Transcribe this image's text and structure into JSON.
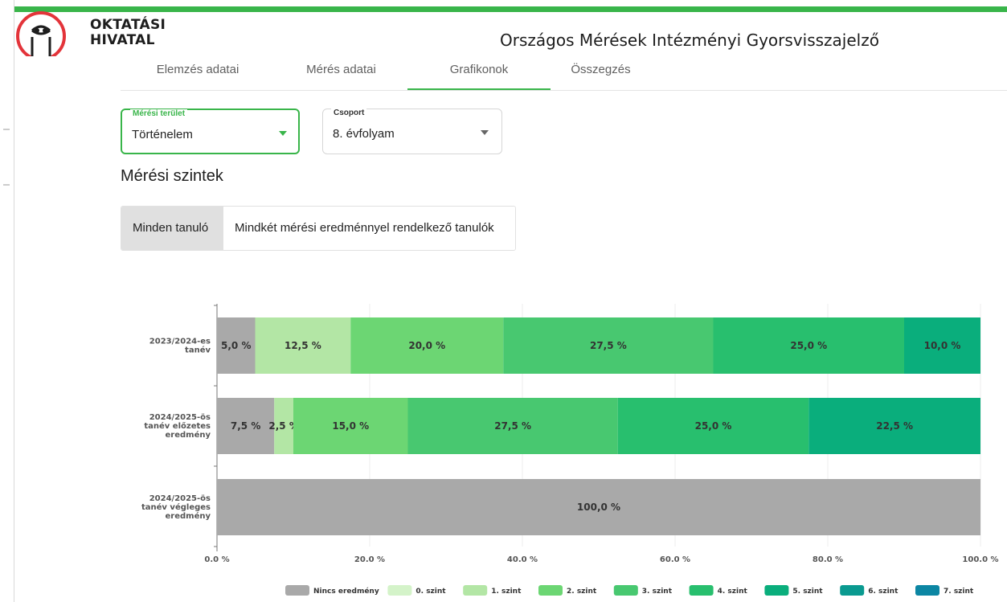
{
  "header": {
    "logo_line1": "OKTATÁSI",
    "logo_line2": "HIVATAL",
    "app_title": "Országos Mérések Intézményi Gyorsvisszajelző",
    "logo_color": "#e3343a",
    "topbar_color": "#39b54a"
  },
  "tabs": [
    {
      "label": "Elemzés adatai",
      "active": false
    },
    {
      "label": "Mérés adatai",
      "active": false
    },
    {
      "label": "Grafikonok",
      "active": true
    },
    {
      "label": "Összegzés",
      "active": false
    }
  ],
  "filters": {
    "area": {
      "label": "Mérési terület",
      "value": "Történelem",
      "accent": "#39b54a"
    },
    "group": {
      "label": "Csoport",
      "value": "8. évfolyam"
    }
  },
  "section_title": "Mérési szintek",
  "toggle": {
    "all_label": "Minden tanuló",
    "both_label": "Mindkét mérési eredménnyel rendelkező tanulók",
    "selected": "all"
  },
  "chart_data": {
    "type": "bar",
    "orientation": "horizontal",
    "stacked": true,
    "categories": [
      [
        "2023/2024-es",
        "tanév"
      ],
      [
        "2024/2025-ös",
        "tanév előzetes",
        "eredmény"
      ],
      [
        "2024/2025-ös",
        "tanév végleges",
        "eredmény"
      ]
    ],
    "series": [
      {
        "name": "Nincs eredmény",
        "color": "#a9a9a9",
        "values": [
          5.0,
          7.5,
          100.0
        ]
      },
      {
        "name": "0. szint",
        "color": "#d4f3c9",
        "values": [
          0,
          0,
          0
        ]
      },
      {
        "name": "1. szint",
        "color": "#b3e6a5",
        "values": [
          12.5,
          2.5,
          0
        ]
      },
      {
        "name": "2. szint",
        "color": "#6cd673",
        "values": [
          20.0,
          15.0,
          0
        ]
      },
      {
        "name": "3. szint",
        "color": "#48c870",
        "values": [
          27.5,
          27.5,
          0
        ]
      },
      {
        "name": "4. szint",
        "color": "#28bf6e",
        "values": [
          25.0,
          25.0,
          0
        ]
      },
      {
        "name": "5. szint",
        "color": "#0aae7c",
        "values": [
          10.0,
          22.5,
          0
        ]
      },
      {
        "name": "6. szint",
        "color": "#0a9a90",
        "values": [
          0,
          0,
          0
        ]
      },
      {
        "name": "7. szint",
        "color": "#0c86a3",
        "values": [
          0,
          0,
          0
        ]
      }
    ],
    "data_labels": [
      [
        "5,0 %",
        "",
        "12,5 %",
        "20,0 %",
        "27,5 %",
        "25,0 %",
        "10,0 %",
        "",
        ""
      ],
      [
        "7,5 %",
        "",
        "2,5 %",
        "15,0 %",
        "27,5 %",
        "25,0 %",
        "22,5 %",
        "",
        ""
      ],
      [
        "100,0 %",
        "",
        "",
        "",
        "",
        "",
        "",
        "",
        ""
      ]
    ],
    "xlim": [
      0,
      100
    ],
    "x_ticks": [
      "0.0 %",
      "20.0 %",
      "40.0 %",
      "60.0 %",
      "80.0 %",
      "100.0 %"
    ],
    "grid": true,
    "legend_position": "bottom"
  }
}
